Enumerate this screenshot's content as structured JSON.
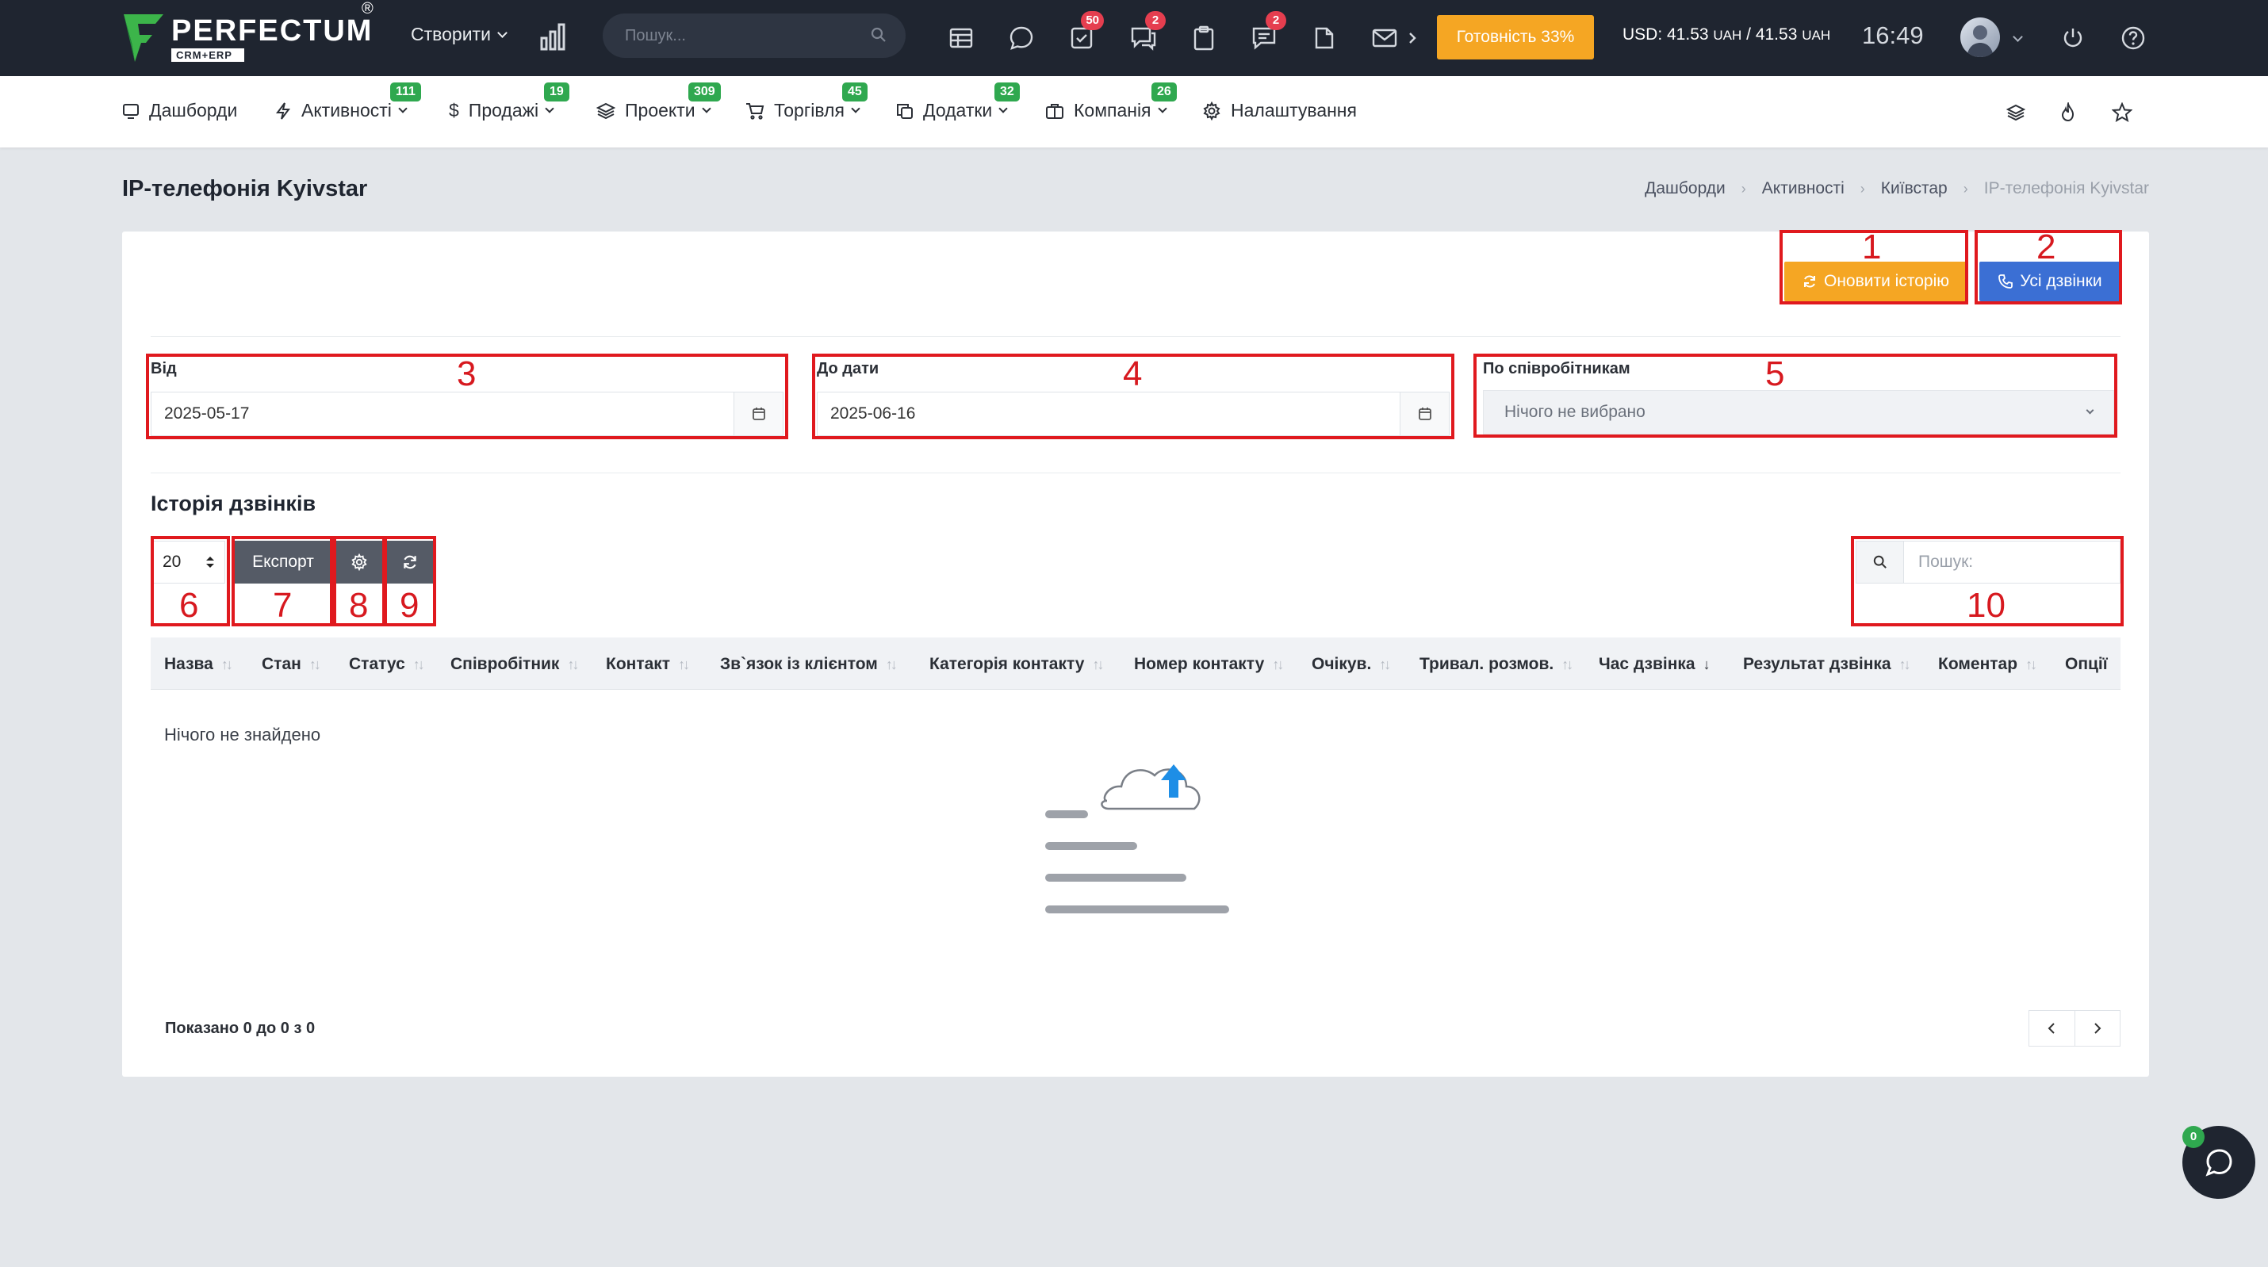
{
  "logo": {
    "name": "PERFECTUM",
    "reg": "®",
    "sub": "CRM+ERP"
  },
  "topbar": {
    "create_label": "Створити",
    "search_placeholder": "Пошук...",
    "badges": {
      "tasks": "50",
      "chat": "2",
      "comments": "2"
    },
    "ready_label": "Готовність 33%",
    "currency_usd": "USD: 41.53",
    "currency_uah1": "UAH",
    "currency_sep": " / 41.53",
    "currency_uah2": "UAH",
    "time": "16:49"
  },
  "nav": {
    "items": [
      {
        "label": "Дашборди",
        "badge": ""
      },
      {
        "label": "Активності",
        "badge": "111"
      },
      {
        "label": "Продажі",
        "badge": "19"
      },
      {
        "label": "Проекти",
        "badge": "309"
      },
      {
        "label": "Торгівля",
        "badge": "45"
      },
      {
        "label": "Додатки",
        "badge": "32"
      },
      {
        "label": "Компанія",
        "badge": "26"
      },
      {
        "label": "Налаштування",
        "badge": ""
      }
    ]
  },
  "page": {
    "title": "IP-телефонія Kyivstar",
    "breadcrumb": [
      "Дашборди",
      "Активності",
      "Київстар",
      "IP-телефонія Kyivstar"
    ]
  },
  "actions": {
    "refresh_history": "Оновити історію",
    "all_calls": "Усі дзвінки"
  },
  "filters": {
    "from_label": "Від",
    "from_value": "2025-05-17",
    "to_label": "До дати",
    "to_value": "2025-06-16",
    "employee_label": "По співробітникам",
    "employee_value": "Нічого не вибрано"
  },
  "table": {
    "title": "Історія дзвінків",
    "page_size": "20",
    "export_label": "Експорт",
    "search_placeholder": "Пошук:",
    "columns": [
      "Назва",
      "Стан",
      "Статус",
      "Співробітник",
      "Контакт",
      "Зв`язок із клієнтом",
      "Категорія контакту",
      "Номер контакту",
      "Очікув.",
      "Тривал. розмов.",
      "Час дзвінка",
      "Результат дзвінка",
      "Коментар",
      "Опції"
    ],
    "empty_text": "Нічого не знайдено",
    "info": "Показано 0 до 0 з 0"
  },
  "annotations": [
    "1",
    "2",
    "3",
    "4",
    "5",
    "6",
    "7",
    "8",
    "9",
    "10"
  ],
  "chat": {
    "badge": "0"
  },
  "colors": {
    "accent_orange": "#f5a623",
    "accent_blue": "#3b6fd4",
    "topbar": "#1f2530",
    "badge_green": "#2fa84f",
    "badge_red": "#e53e4f",
    "annotation": "#e0191e"
  }
}
